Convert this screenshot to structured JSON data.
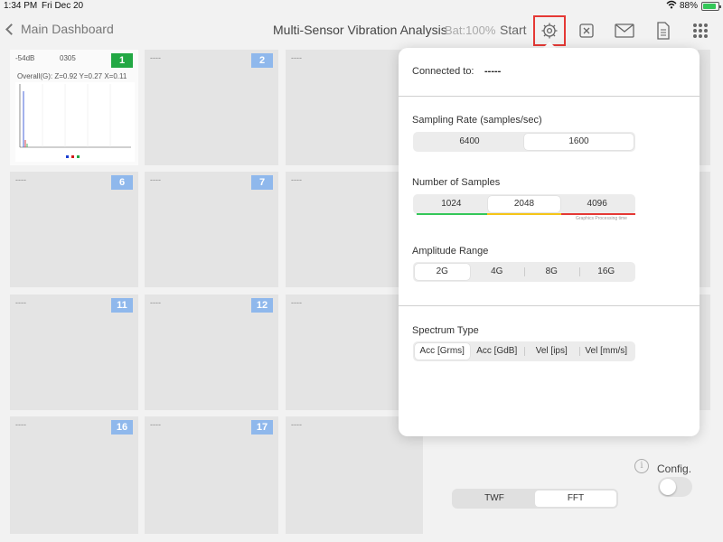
{
  "status_bar": {
    "time": "1:34 PM",
    "date": "Fri Dec 20",
    "battery_pct": "88%",
    "battery_level": 0.88
  },
  "nav": {
    "back_label": "Main Dashboard",
    "title": "Multi-Sensor Vibration Analysis",
    "battery": "Bat:100%",
    "start_label": "Start",
    "icons": [
      "gear-icon",
      "close-box-icon",
      "mail-icon",
      "document-icon",
      "grid-icon"
    ]
  },
  "tiles": [
    {
      "num": "1",
      "label": "",
      "db": "-54dB",
      "code": "0305",
      "overall": "Overall(G): Z=0.92 Y=0.27 X=0.11"
    },
    {
      "num": "2",
      "label": "----"
    },
    {
      "num": "",
      "label": "----"
    },
    {
      "num": "6",
      "label": "----"
    },
    {
      "num": "7",
      "label": "----"
    },
    {
      "num": "",
      "label": "----"
    },
    {
      "num": "11",
      "label": "----"
    },
    {
      "num": "12",
      "label": "----"
    },
    {
      "num": "",
      "label": "----"
    },
    {
      "num": "16",
      "label": "----"
    },
    {
      "num": "17",
      "label": "----"
    },
    {
      "num": "",
      "label": "----"
    }
  ],
  "bottom": {
    "view_options": [
      "TWF",
      "FFT"
    ],
    "view_selected": "FFT",
    "config_label": "Config.",
    "config_on": false
  },
  "settings": {
    "connected_label": "Connected to:",
    "connected_value": "-----",
    "sampling": {
      "label": "Sampling Rate (samples/sec)",
      "options": [
        "6400",
        "1600"
      ],
      "selected": "1600"
    },
    "samples": {
      "label": "Number of Samples",
      "options": [
        "1024",
        "2048",
        "4096"
      ],
      "selected": "2048",
      "bar_colors": [
        "#34c759",
        "#f5c518",
        "#e53935"
      ],
      "note": "Graphics Processing time"
    },
    "amplitude": {
      "label": "Amplitude Range",
      "options": [
        "2G",
        "4G",
        "8G",
        "16G"
      ],
      "selected": "2G"
    },
    "spectrum": {
      "label": "Spectrum Type",
      "options": [
        "Acc [Grms]",
        "Acc [GdB]",
        "Vel [ips]",
        "Vel [mm/s]"
      ],
      "selected": "Acc [Grms]"
    }
  },
  "colors": {
    "accent_red": "#e53935",
    "tile_active": "#22a844",
    "tile_badge": "#8fb8ec"
  }
}
